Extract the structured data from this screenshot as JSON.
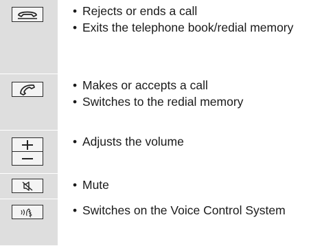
{
  "rows": [
    {
      "icon": "phone-end-icon",
      "bullets": [
        "Rejects or ends a call",
        "Exits the telephone book/redial memory"
      ]
    },
    {
      "icon": "phone-call-icon",
      "bullets": [
        "Makes or accepts a call",
        "Switches to the redial memory"
      ]
    },
    {
      "icon": "volume-plus-minus-icon",
      "bullets": [
        "Adjusts the volume"
      ]
    },
    {
      "icon": "mute-icon",
      "bullets": [
        "Mute"
      ]
    },
    {
      "icon": "voice-control-icon",
      "bullets": [
        "Switches on the Voice Control System"
      ]
    }
  ],
  "bullet_glyph": "•"
}
